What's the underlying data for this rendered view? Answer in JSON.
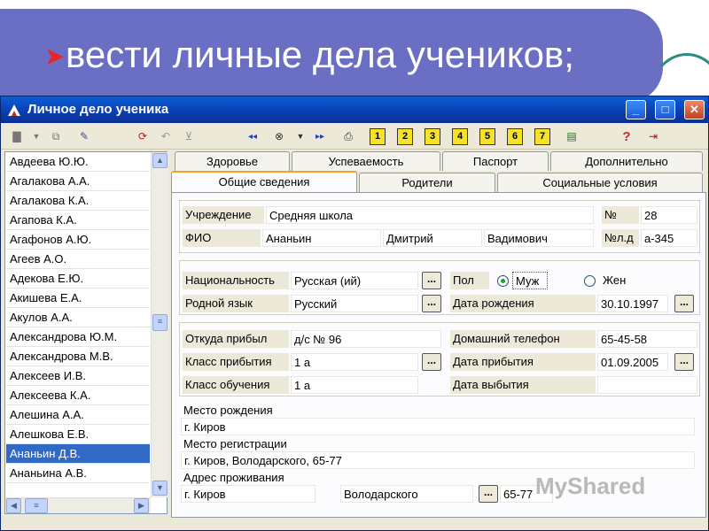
{
  "slide": {
    "bullet_text": "вести личные дела учеников;"
  },
  "window": {
    "title": "Личное дело ученика",
    "controls": {
      "minimize": "_",
      "maximize": "□",
      "close": "✕"
    }
  },
  "toolbar": {
    "numbered_buttons": [
      "1",
      "2",
      "3",
      "4",
      "5",
      "6",
      "7"
    ],
    "help": "?"
  },
  "students": [
    "Авдеева Ю.Ю.",
    "Агалакова А.А.",
    "Агалакова К.А.",
    "Агапова К.А.",
    "Агафонов А.Ю.",
    "Агеев А.О.",
    "Адекова Е.Ю.",
    "Акишева Е.А.",
    "Акулов А.А.",
    "Александрова Ю.М.",
    "Александрова М.В.",
    "Алексеев И.В.",
    "Алексеева К.А.",
    "Алешина А.А.",
    "Алешкова Е.В.",
    "Ананьин Д.В.",
    "Ананьина А.В."
  ],
  "selected_student": "Ананьин Д.В.",
  "tabs_row1": [
    "Здоровье",
    "Успеваемость",
    "Паспорт",
    "Дополнительно"
  ],
  "tabs_row2": [
    "Общие сведения",
    "Родители",
    "Социальные условия"
  ],
  "active_tab": "Общие сведения",
  "form": {
    "institution_label": "Учреждение",
    "institution": "Средняя школа",
    "number_label": "№",
    "number": "28",
    "fio_label": "ФИО",
    "last_name": "Ананьин",
    "first_name": "Дмитрий",
    "patronymic": "Вадимович",
    "file_no_label": "№л.д",
    "file_no": "а-345",
    "nationality_label": "Национальность",
    "nationality": "Русская (ий)",
    "sex_label": "Пол",
    "sex_male": "Муж",
    "sex_female": "Жен",
    "native_lang_label": "Родной язык",
    "native_lang": "Русский",
    "birth_date_label": "Дата рождения",
    "birth_date": "30.10.1997",
    "arrived_from_label": "Откуда прибыл",
    "arrived_from": "д/с № 96",
    "home_phone_label": "Домашний телефон",
    "home_phone": "65-45-58",
    "arrival_class_label": "Класс прибытия",
    "arrival_class": "1 а",
    "arrival_date_label": "Дата прибытия",
    "arrival_date": "01.09.2005",
    "study_class_label": "Класс обучения",
    "study_class": "1 а",
    "leave_date_label": "Дата выбытия",
    "leave_date": "",
    "birthplace_label": "Место рождения",
    "birthplace": "г. Киров",
    "registration_label": "Место регистрации",
    "registration": "г. Киров, Володарского,  65-77",
    "residence_label": "Адрес проживания",
    "residence_city": "г. Киров",
    "residence_street": "Володарского",
    "residence_house": "65-77",
    "dots": "..."
  },
  "watermark": "MyShared"
}
